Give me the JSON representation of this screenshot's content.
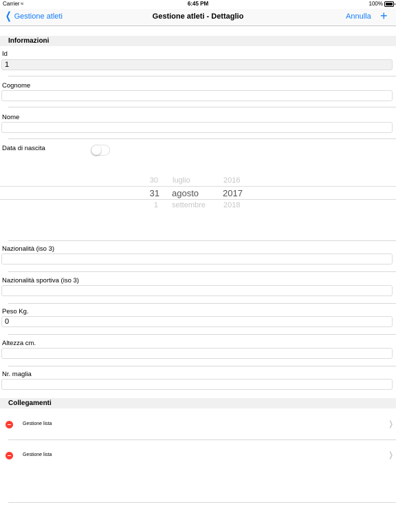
{
  "status_bar": {
    "carrier": "Carrier",
    "time": "6:45 PM",
    "battery": "100%"
  },
  "nav": {
    "back_label": "Gestione atleti",
    "title": "Gestione atleti - Dettaglio",
    "cancel_label": "Annulla",
    "add_label": "+"
  },
  "sections": {
    "info_title": "Informazioni",
    "links_title": "Collegamenti"
  },
  "fields": {
    "id": {
      "label": "Id",
      "value": "1"
    },
    "cognome": {
      "label": "Cognome",
      "value": ""
    },
    "nome": {
      "label": "Nome",
      "value": ""
    },
    "data_nascita": {
      "label": "Data di nascita",
      "enabled": false
    },
    "nazionalita": {
      "label": "Nazionalità (iso 3)",
      "value": ""
    },
    "nazionalita_sportiva": {
      "label": "Nazionalità sportiva (iso 3)",
      "value": ""
    },
    "peso": {
      "label": "Peso Kg.",
      "value": "0"
    },
    "altezza": {
      "label": "Altezza cm.",
      "value": ""
    },
    "maglia": {
      "label": "Nr. maglia",
      "value": ""
    }
  },
  "date_picker": {
    "days": [
      "30",
      "31",
      "1"
    ],
    "months": [
      "luglio",
      "agosto",
      "settembre"
    ],
    "years": [
      "2016",
      "2017",
      "2018"
    ],
    "selected": {
      "day": "31",
      "month": "agosto",
      "year": "2017"
    }
  },
  "links": [
    {
      "label": "Gestione lista"
    },
    {
      "label": "Gestione lista"
    }
  ],
  "colors": {
    "accent": "#147efb",
    "delete": "#ff3b30",
    "section_bg": "#f0f0f0"
  }
}
